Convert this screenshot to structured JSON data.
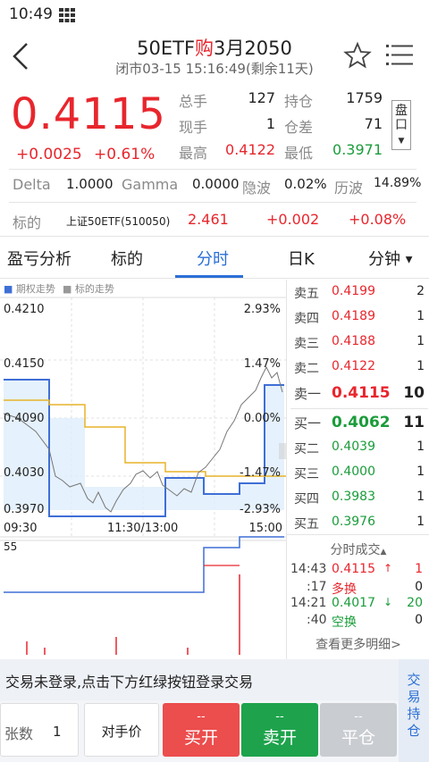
{
  "status_bar": {
    "time": "10:49"
  },
  "header": {
    "title_prefix": "50ETF",
    "title_red": "购",
    "title_suffix": "3月2050",
    "subtitle": "闭市03-15  15:16:49(剩余11天)"
  },
  "quote": {
    "price": "0.4115",
    "change": "+0.0025",
    "change_pct": "+0.61%",
    "stats": [
      {
        "label": "总手",
        "value": "127",
        "label2": "持仓",
        "value2": "1759"
      },
      {
        "label": "现手",
        "value": "1",
        "label2": "仓差",
        "value2": "71"
      },
      {
        "label": "最高",
        "value": "0.4122",
        "label2": "最低",
        "value2": "0.3971"
      }
    ],
    "pankou": "盘口"
  },
  "greeks": {
    "delta_label": "Delta",
    "delta": "1.0000",
    "gamma_label": "Gamma",
    "gamma": "0.0000",
    "iv_label": "隐波",
    "iv": "0.02%",
    "hv_label": "历波",
    "hv": "14.89%"
  },
  "underlying": {
    "label": "标的",
    "name": "上证50ETF(510050)",
    "price": "2.461",
    "change": "+0.002",
    "change_pct": "+0.08%"
  },
  "tabs": [
    {
      "label": "盈亏分析"
    },
    {
      "label": "标的"
    },
    {
      "label": "分时"
    },
    {
      "label": "日K"
    },
    {
      "label": "分钟"
    }
  ],
  "chart": {
    "legend_option": "期权走势",
    "legend_underlying": "标的走势",
    "y_labels": [
      "0.4210",
      "0.4150",
      "0.4090",
      "0.4030",
      "0.3970"
    ],
    "pct_labels": [
      "2.93%",
      "1.47%",
      "0.00%",
      "-1.47%",
      "-2.93%"
    ],
    "x_labels": [
      "09:30",
      "11:30/13:00",
      "15:00"
    ],
    "vol_label": "55",
    "colors": {
      "option": "#3f6fd6",
      "underlying": "#e8b42a",
      "avg": "#777777"
    }
  },
  "book": {
    "asks": [
      {
        "label": "卖五",
        "price": "0.4199",
        "qty": "2"
      },
      {
        "label": "卖四",
        "price": "0.4189",
        "qty": "1"
      },
      {
        "label": "卖三",
        "price": "0.4188",
        "qty": "1"
      },
      {
        "label": "卖二",
        "price": "0.4122",
        "qty": "1"
      },
      {
        "label": "卖一",
        "price": "0.4115",
        "qty": "10"
      }
    ],
    "bids": [
      {
        "label": "买一",
        "price": "0.4062",
        "qty": "11"
      },
      {
        "label": "买二",
        "price": "0.4039",
        "qty": "1"
      },
      {
        "label": "买三",
        "price": "0.4000",
        "qty": "1"
      },
      {
        "label": "买四",
        "price": "0.3983",
        "qty": "1"
      },
      {
        "label": "买五",
        "price": "0.3976",
        "qty": "1"
      }
    ]
  },
  "trades": {
    "title": "分时成交",
    "rows": [
      {
        "time": "14:43",
        "price": "0.4115",
        "arrow": "↑",
        "qty": "1",
        "color": "red"
      },
      {
        "time": ":17",
        "price": "多换",
        "arrow": "",
        "qty": "0",
        "color": "red"
      },
      {
        "time": "14:21",
        "price": "0.4017",
        "arrow": "↓",
        "qty": "20",
        "color": "green"
      },
      {
        "time": ":40",
        "price": "空换",
        "arrow": "",
        "qty": "0",
        "color": "green"
      }
    ],
    "more": "查看更多明细>"
  },
  "bottom": {
    "notice": "交易未登录,点击下方红绿按钮登录交易",
    "side_label": "交易持仓",
    "qty_label": "张数",
    "qty_value": "1",
    "counter_price": "对手价",
    "buy_open": "买开",
    "sell_open": "卖开",
    "close": "平仓",
    "dash": "--"
  }
}
